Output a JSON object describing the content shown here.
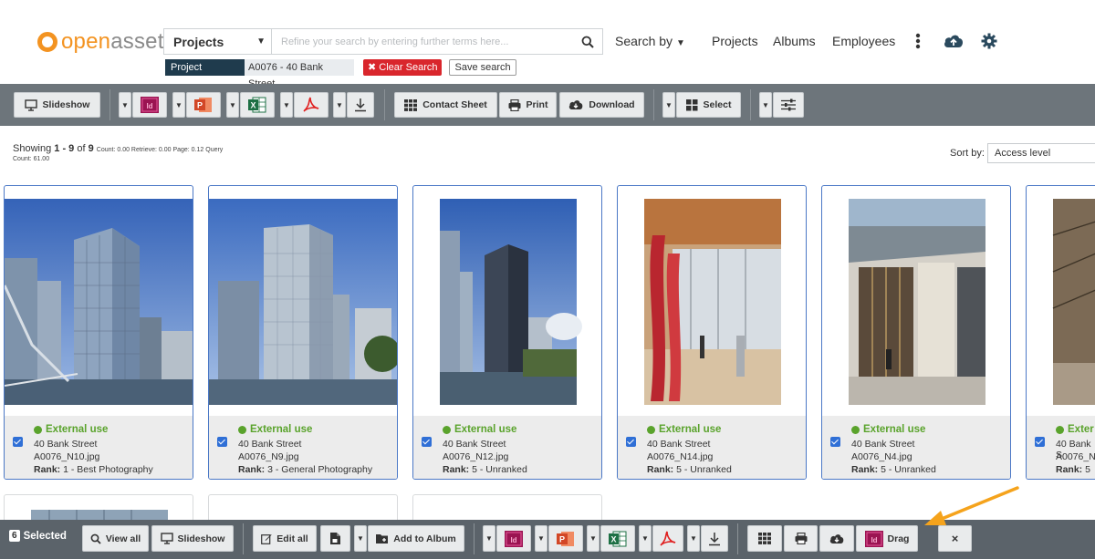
{
  "brand": {
    "name_prefix": "open",
    "name_suffix": "asset",
    "color": "#f39321"
  },
  "search": {
    "scope": "Projects",
    "placeholder": "Refine your search by entering further terms here...",
    "filter_label": "Project",
    "filter_value": "A0076 - 40 Bank Street",
    "clear_label": "Clear Search",
    "save_label": "Save search"
  },
  "nav": {
    "search_by": "Search by",
    "projects": "Projects",
    "albums": "Albums",
    "employees": "Employees"
  },
  "toolbar": {
    "slideshow": "Slideshow",
    "contact_sheet": "Contact Sheet",
    "print": "Print",
    "download": "Download",
    "select": "Select"
  },
  "results": {
    "showing_prefix": "Showing",
    "range": "1 - 9",
    "of_word": "of",
    "total": "9",
    "timing": "Count: 0.00 Retrieve: 0.00 Page: 0.12 Query",
    "count_line": "Count: 61.00",
    "sort_label": "Sort by:",
    "sort_value": "Access level"
  },
  "cards": [
    {
      "status": "External use",
      "project": "40 Bank Street",
      "file": "A0076_N10.jpg",
      "rank_label": "Rank:",
      "rank": "1 - Best Photography"
    },
    {
      "status": "External use",
      "project": "40 Bank Street",
      "file": "A0076_N9.jpg",
      "rank_label": "Rank:",
      "rank": "3 - General Photography"
    },
    {
      "status": "External use",
      "project": "40 Bank Street",
      "file": "A0076_N12.jpg",
      "rank_label": "Rank:",
      "rank": "5 - Unranked"
    },
    {
      "status": "External use",
      "project": "40 Bank Street",
      "file": "A0076_N14.jpg",
      "rank_label": "Rank:",
      "rank": "5 - Unranked"
    },
    {
      "status": "External use",
      "project": "40 Bank Street",
      "file": "A0076_N4.jpg",
      "rank_label": "Rank:",
      "rank": "5 - Unranked"
    },
    {
      "status": "Exter",
      "project": "40 Bank S",
      "file": "A0076_N",
      "rank_label": "Rank:",
      "rank": "5"
    }
  ],
  "selection_bar": {
    "count": "6",
    "selected_label": "Selected",
    "view_all": "View all",
    "slideshow": "Slideshow",
    "edit_all": "Edit all",
    "add_to_album": "Add to Album",
    "drag": "Drag",
    "close": "×"
  },
  "colors": {
    "toolbar_bg": "#6d757b",
    "selection_bar_bg": "#5b636a",
    "card_border": "#4b78c6",
    "status_green": "#5aa32c",
    "clear_red": "#d9262c",
    "arrow_orange": "#f5a31c",
    "indesign": "#9b1452",
    "powerpoint": "#d24726",
    "excel": "#1d7044",
    "pdf": "#e02020"
  }
}
